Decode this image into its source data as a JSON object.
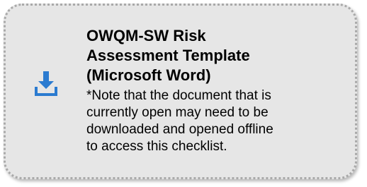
{
  "card": {
    "icon": "download-icon",
    "accent_color": "#2b7bd0",
    "title_lines": [
      "OWQM-SW Risk",
      "Assessment Template",
      "(Microsoft Word)"
    ],
    "note_lines": [
      "*Note that the document that is",
      "currently open may need to be",
      "downloaded and opened offline",
      "to access this checklist."
    ]
  }
}
